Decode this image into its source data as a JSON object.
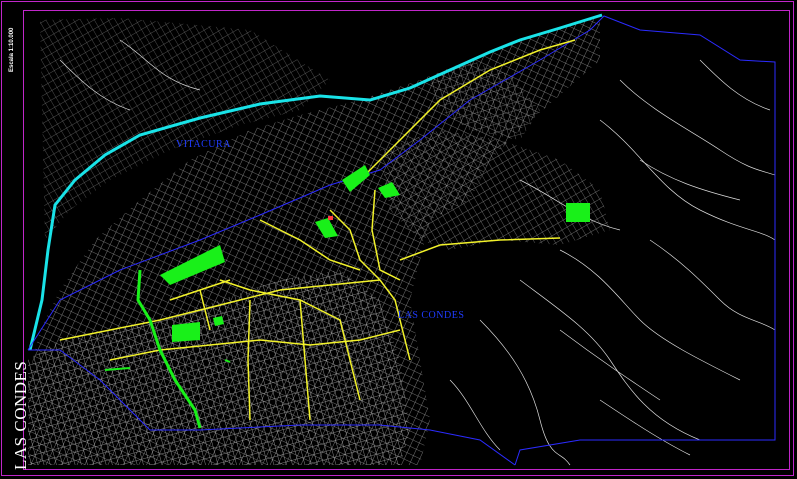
{
  "map": {
    "municipality_title": "LAS CONDES",
    "scale_text": "Escala 1:10.000",
    "districts": [
      {
        "id": "vitacura",
        "label": "VITACURA"
      },
      {
        "id": "las-condes",
        "label": "LAS CONDES"
      }
    ],
    "colors": {
      "background": "#000000",
      "frame": "#c026c9",
      "streets": "#c8c8c8",
      "main_roads": "#f2f22a",
      "river": "#19e3e8",
      "boundary": "#2b2bff",
      "parks": "#19f019",
      "labels": "#1f3bff"
    }
  }
}
